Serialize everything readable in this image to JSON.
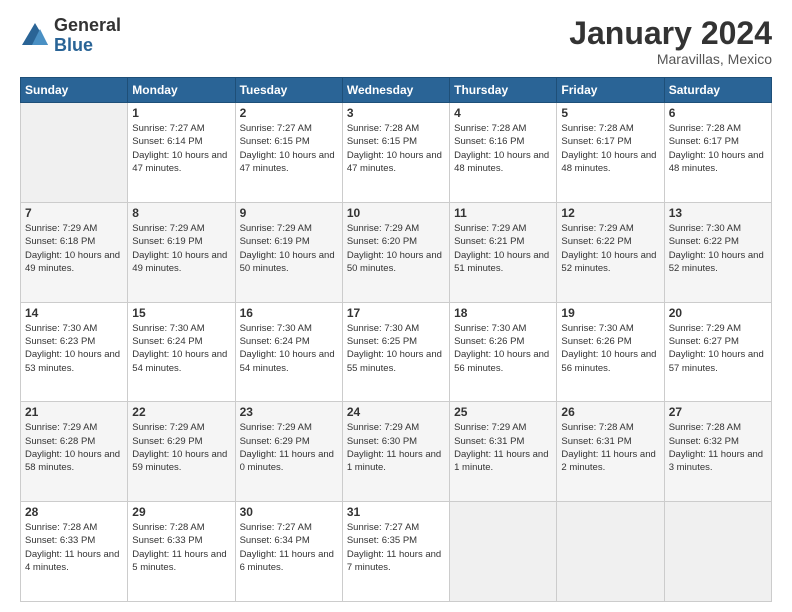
{
  "header": {
    "logo_general": "General",
    "logo_blue": "Blue",
    "month_year": "January 2024",
    "location": "Maravillas, Mexico"
  },
  "calendar": {
    "days_of_week": [
      "Sunday",
      "Monday",
      "Tuesday",
      "Wednesday",
      "Thursday",
      "Friday",
      "Saturday"
    ],
    "weeks": [
      [
        {
          "num": "",
          "sunrise": "",
          "sunset": "",
          "daylight": "",
          "empty": true
        },
        {
          "num": "1",
          "sunrise": "Sunrise: 7:27 AM",
          "sunset": "Sunset: 6:14 PM",
          "daylight": "Daylight: 10 hours and 47 minutes."
        },
        {
          "num": "2",
          "sunrise": "Sunrise: 7:27 AM",
          "sunset": "Sunset: 6:15 PM",
          "daylight": "Daylight: 10 hours and 47 minutes."
        },
        {
          "num": "3",
          "sunrise": "Sunrise: 7:28 AM",
          "sunset": "Sunset: 6:15 PM",
          "daylight": "Daylight: 10 hours and 47 minutes."
        },
        {
          "num": "4",
          "sunrise": "Sunrise: 7:28 AM",
          "sunset": "Sunset: 6:16 PM",
          "daylight": "Daylight: 10 hours and 48 minutes."
        },
        {
          "num": "5",
          "sunrise": "Sunrise: 7:28 AM",
          "sunset": "Sunset: 6:17 PM",
          "daylight": "Daylight: 10 hours and 48 minutes."
        },
        {
          "num": "6",
          "sunrise": "Sunrise: 7:28 AM",
          "sunset": "Sunset: 6:17 PM",
          "daylight": "Daylight: 10 hours and 48 minutes."
        }
      ],
      [
        {
          "num": "7",
          "sunrise": "Sunrise: 7:29 AM",
          "sunset": "Sunset: 6:18 PM",
          "daylight": "Daylight: 10 hours and 49 minutes."
        },
        {
          "num": "8",
          "sunrise": "Sunrise: 7:29 AM",
          "sunset": "Sunset: 6:19 PM",
          "daylight": "Daylight: 10 hours and 49 minutes."
        },
        {
          "num": "9",
          "sunrise": "Sunrise: 7:29 AM",
          "sunset": "Sunset: 6:19 PM",
          "daylight": "Daylight: 10 hours and 50 minutes."
        },
        {
          "num": "10",
          "sunrise": "Sunrise: 7:29 AM",
          "sunset": "Sunset: 6:20 PM",
          "daylight": "Daylight: 10 hours and 50 minutes."
        },
        {
          "num": "11",
          "sunrise": "Sunrise: 7:29 AM",
          "sunset": "Sunset: 6:21 PM",
          "daylight": "Daylight: 10 hours and 51 minutes."
        },
        {
          "num": "12",
          "sunrise": "Sunrise: 7:29 AM",
          "sunset": "Sunset: 6:22 PM",
          "daylight": "Daylight: 10 hours and 52 minutes."
        },
        {
          "num": "13",
          "sunrise": "Sunrise: 7:30 AM",
          "sunset": "Sunset: 6:22 PM",
          "daylight": "Daylight: 10 hours and 52 minutes."
        }
      ],
      [
        {
          "num": "14",
          "sunrise": "Sunrise: 7:30 AM",
          "sunset": "Sunset: 6:23 PM",
          "daylight": "Daylight: 10 hours and 53 minutes."
        },
        {
          "num": "15",
          "sunrise": "Sunrise: 7:30 AM",
          "sunset": "Sunset: 6:24 PM",
          "daylight": "Daylight: 10 hours and 54 minutes."
        },
        {
          "num": "16",
          "sunrise": "Sunrise: 7:30 AM",
          "sunset": "Sunset: 6:24 PM",
          "daylight": "Daylight: 10 hours and 54 minutes."
        },
        {
          "num": "17",
          "sunrise": "Sunrise: 7:30 AM",
          "sunset": "Sunset: 6:25 PM",
          "daylight": "Daylight: 10 hours and 55 minutes."
        },
        {
          "num": "18",
          "sunrise": "Sunrise: 7:30 AM",
          "sunset": "Sunset: 6:26 PM",
          "daylight": "Daylight: 10 hours and 56 minutes."
        },
        {
          "num": "19",
          "sunrise": "Sunrise: 7:30 AM",
          "sunset": "Sunset: 6:26 PM",
          "daylight": "Daylight: 10 hours and 56 minutes."
        },
        {
          "num": "20",
          "sunrise": "Sunrise: 7:29 AM",
          "sunset": "Sunset: 6:27 PM",
          "daylight": "Daylight: 10 hours and 57 minutes."
        }
      ],
      [
        {
          "num": "21",
          "sunrise": "Sunrise: 7:29 AM",
          "sunset": "Sunset: 6:28 PM",
          "daylight": "Daylight: 10 hours and 58 minutes."
        },
        {
          "num": "22",
          "sunrise": "Sunrise: 7:29 AM",
          "sunset": "Sunset: 6:29 PM",
          "daylight": "Daylight: 10 hours and 59 minutes."
        },
        {
          "num": "23",
          "sunrise": "Sunrise: 7:29 AM",
          "sunset": "Sunset: 6:29 PM",
          "daylight": "Daylight: 11 hours and 0 minutes."
        },
        {
          "num": "24",
          "sunrise": "Sunrise: 7:29 AM",
          "sunset": "Sunset: 6:30 PM",
          "daylight": "Daylight: 11 hours and 1 minute."
        },
        {
          "num": "25",
          "sunrise": "Sunrise: 7:29 AM",
          "sunset": "Sunset: 6:31 PM",
          "daylight": "Daylight: 11 hours and 1 minute."
        },
        {
          "num": "26",
          "sunrise": "Sunrise: 7:28 AM",
          "sunset": "Sunset: 6:31 PM",
          "daylight": "Daylight: 11 hours and 2 minutes."
        },
        {
          "num": "27",
          "sunrise": "Sunrise: 7:28 AM",
          "sunset": "Sunset: 6:32 PM",
          "daylight": "Daylight: 11 hours and 3 minutes."
        }
      ],
      [
        {
          "num": "28",
          "sunrise": "Sunrise: 7:28 AM",
          "sunset": "Sunset: 6:33 PM",
          "daylight": "Daylight: 11 hours and 4 minutes."
        },
        {
          "num": "29",
          "sunrise": "Sunrise: 7:28 AM",
          "sunset": "Sunset: 6:33 PM",
          "daylight": "Daylight: 11 hours and 5 minutes."
        },
        {
          "num": "30",
          "sunrise": "Sunrise: 7:27 AM",
          "sunset": "Sunset: 6:34 PM",
          "daylight": "Daylight: 11 hours and 6 minutes."
        },
        {
          "num": "31",
          "sunrise": "Sunrise: 7:27 AM",
          "sunset": "Sunset: 6:35 PM",
          "daylight": "Daylight: 11 hours and 7 minutes."
        },
        {
          "num": "",
          "sunrise": "",
          "sunset": "",
          "daylight": "",
          "empty": true
        },
        {
          "num": "",
          "sunrise": "",
          "sunset": "",
          "daylight": "",
          "empty": true
        },
        {
          "num": "",
          "sunrise": "",
          "sunset": "",
          "daylight": "",
          "empty": true
        }
      ]
    ]
  }
}
